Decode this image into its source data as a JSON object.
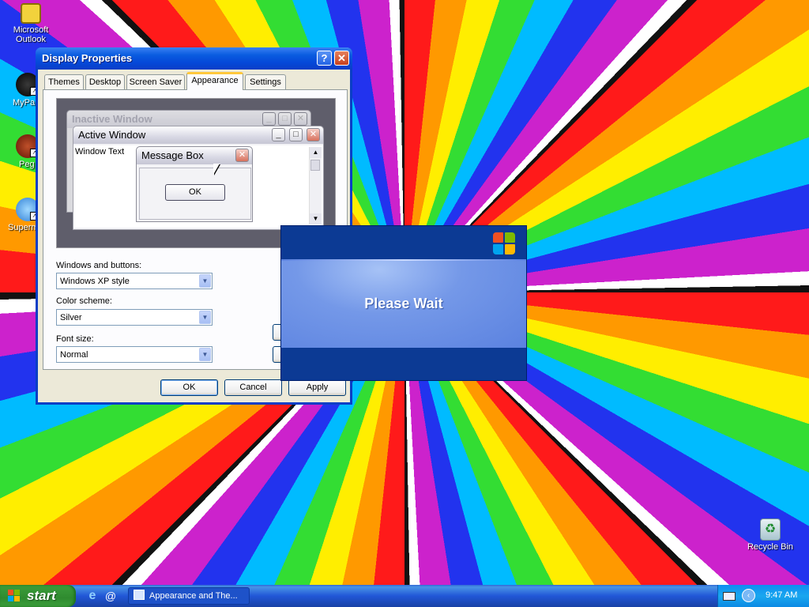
{
  "desktop": {
    "icons": [
      {
        "label": "Microsoft Outlook"
      },
      {
        "label": "MyPa"
      },
      {
        "label": "Peg"
      },
      {
        "label": "Superm"
      },
      {
        "label": "Recycle Bin"
      }
    ]
  },
  "display_properties": {
    "title": "Display Properties",
    "help_label": "?",
    "close_label": "✕",
    "tabs": [
      {
        "label": "Themes"
      },
      {
        "label": "Desktop"
      },
      {
        "label": "Screen Saver"
      },
      {
        "label": "Appearance",
        "active": true
      },
      {
        "label": "Settings"
      }
    ],
    "preview": {
      "inactive_title": "Inactive Window",
      "active_title": "Active Window",
      "window_text": "Window Text",
      "message_box_title": "Message Box",
      "ok_label": "OK"
    },
    "windows_buttons_label": "Windows and buttons:",
    "windows_buttons_value": "Windows XP style",
    "color_scheme_label": "Color scheme:",
    "color_scheme_value": "Silver",
    "font_size_label": "Font size:",
    "font_size_value": "Normal",
    "ok_label": "OK",
    "cancel_label": "Cancel",
    "apply_label": "Apply"
  },
  "please_wait": {
    "message": "Please Wait"
  },
  "taskbar": {
    "start_label": "start",
    "task_label": "Appearance and The...",
    "clock": "9:47 AM"
  },
  "colors": {
    "xp_blue": "#0a3ec6",
    "start_green": "#2f8b2f",
    "wait_dark": "#0c3a94",
    "wait_light": "#5b82e0"
  }
}
